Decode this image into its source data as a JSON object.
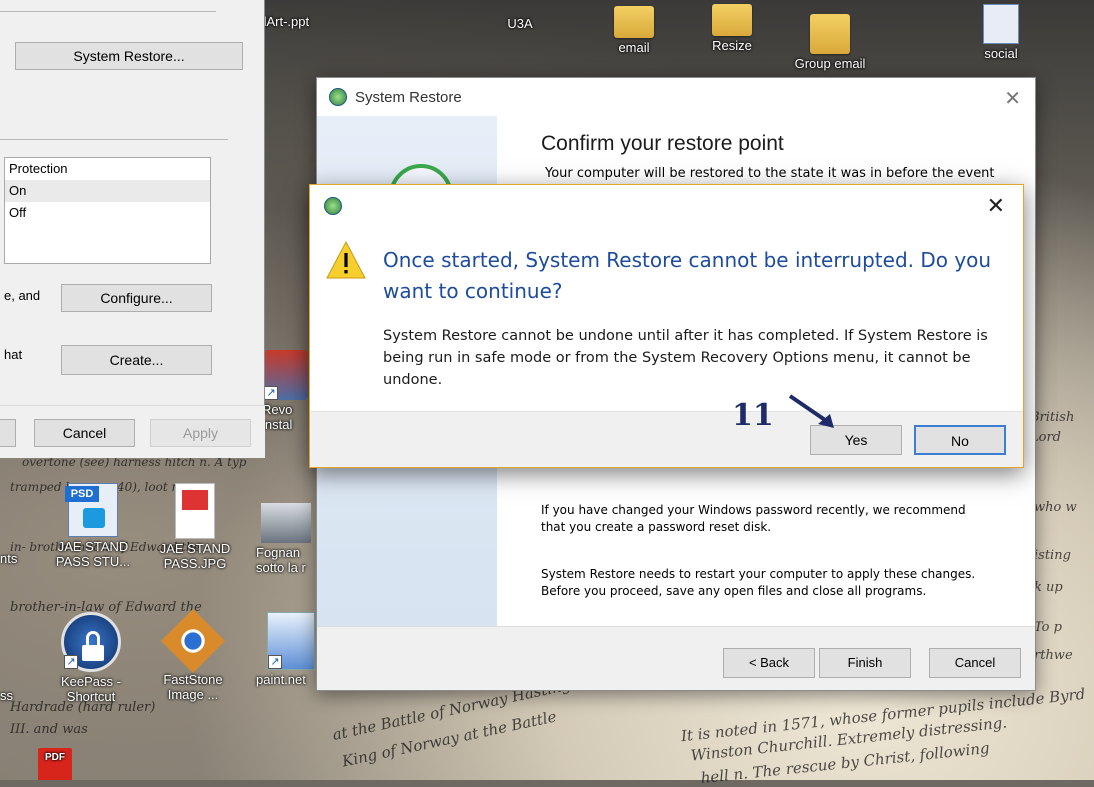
{
  "desktop": {
    "icons": [
      {
        "label": "ndArt-.ppt",
        "icon": "powerpoint-file-icon"
      },
      {
        "label": "U3A",
        "icon": "folder-icon"
      },
      {
        "label": "email",
        "icon": "folder-icon"
      },
      {
        "label": "Resize",
        "icon": "folder-icon"
      },
      {
        "label": "Group email",
        "icon": "folder-icon"
      },
      {
        "label": "social",
        "icon": "document-icon"
      },
      {
        "label": "Revo\ninstal",
        "icon": "revo-uninstaller-icon"
      },
      {
        "label": "JAE STAND\nPASS STU...",
        "icon": "psd-file-icon"
      },
      {
        "label": "JAE STAND\nPASS.JPG",
        "icon": "jpg-file-icon"
      },
      {
        "label": "Fognan\nsotto la r",
        "icon": "image-file-icon"
      },
      {
        "label": "nts",
        "icon": "document-icon"
      },
      {
        "label": "KeePass -\nShortcut",
        "icon": "keepass-icon"
      },
      {
        "label": "FastStone\nImage ...",
        "icon": "faststone-icon"
      },
      {
        "label": "paint.net",
        "icon": "paintnet-icon"
      },
      {
        "label": "ss",
        "icon": "document-icon"
      },
      {
        "label": "PDF",
        "icon": "pdf-file-icon"
      }
    ],
    "step_annotation": "11"
  },
  "system_properties": {
    "system_restore_button": "System Restore...",
    "protection_header": "Protection",
    "protection_rows": [
      "On",
      "Off"
    ],
    "configure_label_fragment": "e, and",
    "configure_button": "Configure...",
    "create_label_fragment": "hat",
    "create_button": "Create...",
    "cancel_button": "Cancel",
    "apply_button": "Apply"
  },
  "wizard": {
    "title": "System Restore",
    "heading": "Confirm your restore point",
    "intro": "Your computer will be restored to the state it was in before the event",
    "password_note_1": "If you have changed your Windows password recently, we recommend",
    "password_note_2": "that you create a password reset disk.",
    "restart_note_1": "System Restore needs to restart your computer to apply these changes.",
    "restart_note_2": "Before you proceed, save any open files and close all programs.",
    "back_button": "< Back",
    "finish_button": "Finish",
    "cancel_button": "Cancel"
  },
  "confirm_dialog": {
    "main_instruction": "Once started, System Restore cannot be interrupted. Do you want to continue?",
    "content": "System Restore cannot be undone until after it has completed. If System Restore is being run in safe mode or from the System Recovery Options menu, it cannot be undone.",
    "yes_button": "Yes",
    "no_button": "No"
  }
}
